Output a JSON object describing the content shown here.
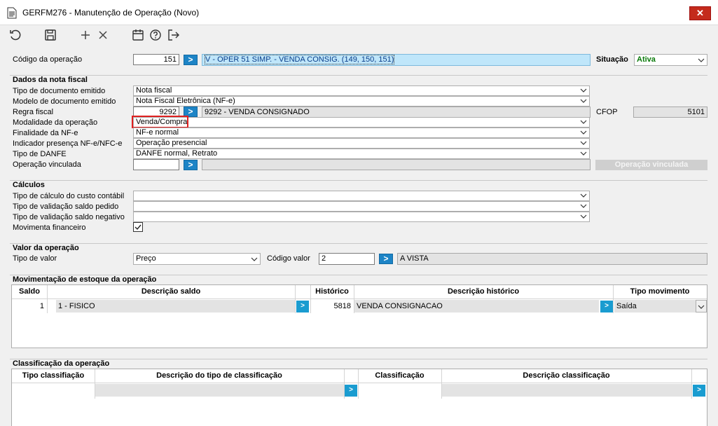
{
  "window": {
    "title": "GERFM276 - Manutenção de Operação (Novo)",
    "close_label": "✕"
  },
  "toolbar": {
    "icons": [
      "undo-icon",
      "save-icon",
      "add-icon",
      "delete-icon",
      "calendar-icon",
      "help-icon",
      "exit-icon"
    ]
  },
  "header": {
    "codigo_label": "Código da operação",
    "codigo_value": "151",
    "go_label": ">",
    "descricao_value": "V - OPER 51 SIMP. - VENDA CONSIG. (149, 150, 151)",
    "situacao_label": "Situação",
    "situacao_value": "Ativa"
  },
  "nota_fiscal": {
    "title": "Dados da nota fiscal",
    "tipo_doc_label": "Tipo de documento emitido",
    "tipo_doc_value": "Nota fiscal",
    "modelo_doc_label": "Modelo de documento emitido",
    "modelo_doc_value": "Nota Fiscal Eletrônica (NF-e)",
    "regra_label": "Regra fiscal",
    "regra_code": "9292",
    "regra_desc": "9292 - VENDA CONSIGNADO",
    "cfop_label": "CFOP",
    "cfop_value": "5101",
    "modalidade_label": "Modalidade da operação",
    "modalidade_value": "Venda/Compra",
    "finalidade_label": "Finalidade da NF-e",
    "finalidade_value": "NF-e normal",
    "indicador_label": "Indicador presença NF-e/NFC-e",
    "indicador_value": "Operação presencial",
    "danfe_label": "Tipo de DANFE",
    "danfe_value": "DANFE normal, Retrato",
    "vinculada_label": "Operação vinculada",
    "vinculada_code": "",
    "vinculada_desc": "",
    "vinculada_button": "Operação vinculada"
  },
  "calculos": {
    "title": "Cálculos",
    "custo_label": "Tipo de cálculo do custo contábil",
    "custo_value": "",
    "saldo_pedido_label": "Tipo de validação saldo pedido",
    "saldo_pedido_value": "",
    "saldo_negativo_label": "Tipo de validação saldo negativo",
    "saldo_negativo_value": "",
    "financeiro_label": "Movimenta financeiro",
    "financeiro_checked": true
  },
  "valor": {
    "title": "Valor da operação",
    "tipo_label": "Tipo de valor",
    "tipo_value": "Preço",
    "codigo_label": "Código valor",
    "codigo_value": "2",
    "desc_value": "A VISTA"
  },
  "estoque": {
    "title": "Movimentação de estoque da operação",
    "columns": [
      "Saldo",
      "Descrição saldo",
      "Histórico",
      "Descrição histórico",
      "Tipo movimento"
    ],
    "rows": [
      {
        "saldo": "1",
        "descricao_saldo": "1 - FISICO",
        "historico": "5818",
        "descricao_historico": "VENDA CONSIGNACAO",
        "tipo_movimento": "Saída"
      }
    ]
  },
  "classificacao": {
    "title": "Classificação da operação",
    "columns": [
      "Tipo classifiação",
      "Descrição do tipo de classificação",
      "Classificação",
      "Descrição classificação"
    ]
  },
  "colors": {
    "accent": "#1d84c6",
    "highlight_border": "#e02020",
    "ativa_text": "#0a7a0a",
    "close_bg": "#c42b1c"
  }
}
